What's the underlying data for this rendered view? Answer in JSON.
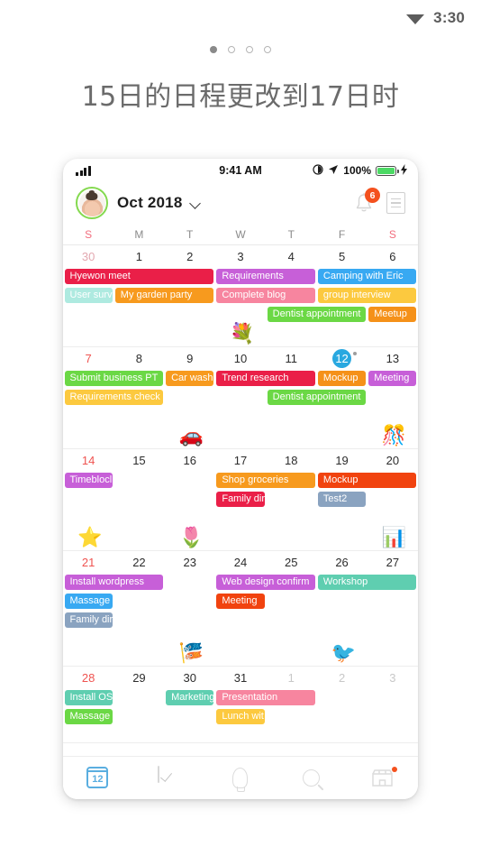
{
  "os_status": {
    "time": "3:30",
    "wifi_icon": "wifi-icon"
  },
  "carousel": {
    "dots_total": 4,
    "active_index": 0
  },
  "headline": "15日的日程更改到17日时",
  "phone": {
    "status_bar": {
      "signal_icon": "cellular-signal-icon",
      "time": "9:41 AM",
      "alarm_icon": "alarm-icon",
      "location_icon": "location-arrow-icon",
      "battery_pct": "100%",
      "battery_icon": "battery-icon",
      "charging_icon": "lightning-bolt-icon"
    },
    "header": {
      "avatar": "user-avatar",
      "month_label": "Oct 2018",
      "chevron_icon": "chevron-down-icon",
      "bell_icon": "bell-icon",
      "bell_badge": "6",
      "menu_icon": "list-menu-icon"
    },
    "weekdays": [
      "S",
      "M",
      "T",
      "W",
      "T",
      "F",
      "S"
    ],
    "weeks": [
      {
        "days": [
          {
            "n": "30",
            "style": "mut"
          },
          {
            "n": "1"
          },
          {
            "n": "2"
          },
          {
            "n": "3"
          },
          {
            "n": "4"
          },
          {
            "n": "5"
          },
          {
            "n": "6"
          }
        ],
        "events": [
          {
            "label": "Hyewon meet",
            "start": 0,
            "span": 3,
            "row": 0,
            "color": "#ea1f48"
          },
          {
            "label": "Requirements",
            "start": 3,
            "span": 2,
            "row": 0,
            "color": "#c75fd8"
          },
          {
            "label": "Camping with Eric",
            "start": 5,
            "span": 2,
            "row": 0,
            "color": "#38a9f2"
          },
          {
            "label": "User surv",
            "start": 0,
            "span": 1,
            "row": 1,
            "color": "#aeeae0"
          },
          {
            "label": "My garden party",
            "start": 1,
            "span": 2,
            "row": 1,
            "color": "#f79a1e"
          },
          {
            "label": "Complete blog",
            "start": 3,
            "span": 2,
            "row": 1,
            "color": "#f7859f"
          },
          {
            "label": "group interview",
            "start": 5,
            "span": 2,
            "row": 1,
            "color": "#fcc93f"
          },
          {
            "label": "Dentist appointment",
            "start": 4,
            "span": 2,
            "row": 2,
            "color": "#6bd845"
          },
          {
            "label": "Meetup",
            "start": 6,
            "span": 1,
            "row": 2,
            "color": "#f59119"
          }
        ],
        "stickers": [
          {
            "glyph": "💐",
            "col": 3,
            "name": "bouquet-sticker"
          }
        ]
      },
      {
        "days": [
          {
            "n": "7",
            "style": "sun"
          },
          {
            "n": "8"
          },
          {
            "n": "9"
          },
          {
            "n": "10"
          },
          {
            "n": "11"
          },
          {
            "n": "12",
            "style": "today",
            "dot": true
          },
          {
            "n": "13"
          }
        ],
        "events": [
          {
            "label": "Submit business PT",
            "start": 0,
            "span": 2,
            "row": 0,
            "color": "#6bd845"
          },
          {
            "label": "Car wash",
            "start": 2,
            "span": 1,
            "row": 0,
            "color": "#f79a1e"
          },
          {
            "label": "Trend research",
            "start": 3,
            "span": 2,
            "row": 0,
            "color": "#ea1f48"
          },
          {
            "label": "Mockup",
            "start": 5,
            "span": 1,
            "row": 0,
            "color": "#f59119"
          },
          {
            "label": "Meeting",
            "start": 6,
            "span": 1,
            "row": 0,
            "color": "#c75fd8"
          },
          {
            "label": "Requirements check",
            "start": 0,
            "span": 2,
            "row": 1,
            "color": "#fcc93f"
          },
          {
            "label": "Dentist appointment",
            "start": 4,
            "span": 2,
            "row": 1,
            "color": "#6bd845"
          }
        ],
        "stickers": [
          {
            "glyph": "🚗",
            "col": 2,
            "name": "car-sticker"
          },
          {
            "glyph": "🎊",
            "col": 6,
            "name": "confetti-sticker"
          }
        ]
      },
      {
        "days": [
          {
            "n": "14",
            "style": "sun"
          },
          {
            "n": "15"
          },
          {
            "n": "16"
          },
          {
            "n": "17"
          },
          {
            "n": "18"
          },
          {
            "n": "19"
          },
          {
            "n": "20"
          }
        ],
        "events": [
          {
            "label": "Timeblocl",
            "start": 0,
            "span": 1,
            "row": 0,
            "color": "#c75fd8"
          },
          {
            "label": "Shop groceries",
            "start": 3,
            "span": 2,
            "row": 0,
            "color": "#f79a1e"
          },
          {
            "label": "Mockup",
            "start": 5,
            "span": 2,
            "row": 0,
            "color": "#f1430f"
          },
          {
            "label": "Family dir",
            "start": 3,
            "span": 1,
            "row": 1,
            "color": "#ea1f48"
          },
          {
            "label": "Test2",
            "start": 5,
            "span": 1,
            "row": 1,
            "color": "#8aa3c0"
          }
        ],
        "stickers": [
          {
            "glyph": "⭐",
            "col": 0,
            "name": "star-sticker"
          },
          {
            "glyph": "🌷",
            "col": 2,
            "name": "tulip-sticker"
          },
          {
            "glyph": "📊",
            "col": 6,
            "name": "bar-chart-sticker"
          }
        ]
      },
      {
        "days": [
          {
            "n": "21",
            "style": "sun"
          },
          {
            "n": "22"
          },
          {
            "n": "23"
          },
          {
            "n": "24"
          },
          {
            "n": "25"
          },
          {
            "n": "26"
          },
          {
            "n": "27"
          }
        ],
        "events": [
          {
            "label": "Install wordpress",
            "start": 0,
            "span": 2,
            "row": 0,
            "color": "#c75fd8"
          },
          {
            "label": "Web design confirm",
            "start": 3,
            "span": 2,
            "row": 0,
            "color": "#c75fd8"
          },
          {
            "label": "Workshop",
            "start": 5,
            "span": 2,
            "row": 0,
            "color": "#5fceb0"
          },
          {
            "label": "Massage",
            "start": 0,
            "span": 1,
            "row": 1,
            "color": "#38a9f2"
          },
          {
            "label": "Meeting",
            "start": 3,
            "span": 1,
            "row": 1,
            "color": "#f1430f"
          },
          {
            "label": "Family dir",
            "start": 0,
            "span": 1,
            "row": 2,
            "color": "#8aa3c0"
          }
        ],
        "stickers": [
          {
            "glyph": "🎏",
            "col": 2,
            "name": "party-flags-sticker"
          },
          {
            "glyph": "🐦",
            "col": 5,
            "name": "lovebirds-sticker"
          }
        ]
      },
      {
        "days": [
          {
            "n": "28",
            "style": "sun"
          },
          {
            "n": "29"
          },
          {
            "n": "30"
          },
          {
            "n": "31"
          },
          {
            "n": "1",
            "style": "out"
          },
          {
            "n": "2",
            "style": "out"
          },
          {
            "n": "3",
            "style": "out"
          }
        ],
        "events": [
          {
            "label": "Install OS",
            "start": 0,
            "span": 1,
            "row": 0,
            "color": "#5fceb0"
          },
          {
            "label": "Marketing",
            "start": 2,
            "span": 1,
            "row": 0,
            "color": "#5fceb0"
          },
          {
            "label": "Presentation",
            "start": 3,
            "span": 2,
            "row": 0,
            "color": "#f7859f"
          },
          {
            "label": "Massage",
            "start": 0,
            "span": 1,
            "row": 1,
            "color": "#6bd845"
          },
          {
            "label": "Lunch wit",
            "start": 3,
            "span": 1,
            "row": 1,
            "color": "#fcc93f"
          }
        ],
        "stickers": []
      }
    ],
    "bottom_nav": [
      {
        "name": "nav-calendar",
        "icon": "calendar-icon",
        "label": "12",
        "active": true
      },
      {
        "name": "nav-tasks",
        "icon": "checkbox-icon",
        "active": false
      },
      {
        "name": "nav-ideas",
        "icon": "lightbulb-icon",
        "active": false
      },
      {
        "name": "nav-search",
        "icon": "search-icon",
        "active": false
      },
      {
        "name": "nav-store",
        "icon": "store-icon",
        "active": false,
        "dot": true
      }
    ]
  },
  "colors": {
    "accent_blue": "#29a8e0",
    "badge_red": "#f4511e",
    "sunday_red": "#ef5350"
  }
}
